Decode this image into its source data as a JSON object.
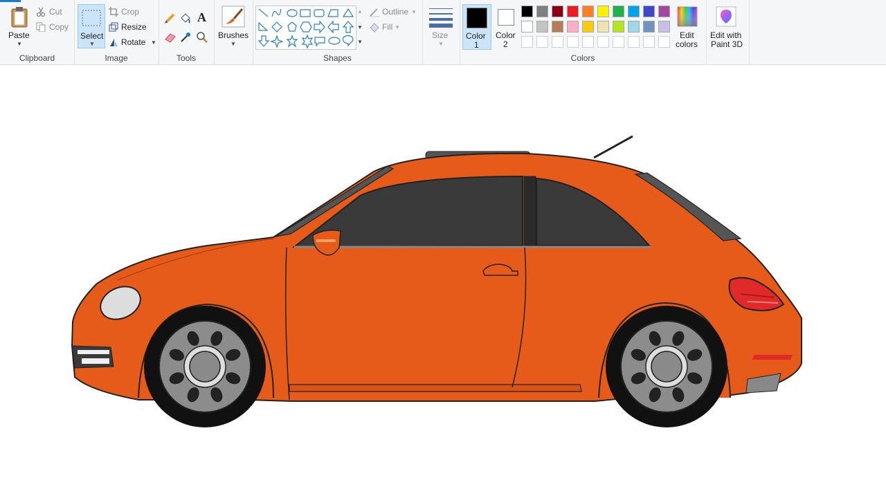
{
  "clipboard": {
    "paste": "Paste",
    "cut": "Cut",
    "copy": "Copy",
    "group": "Clipboard"
  },
  "image": {
    "select": "Select",
    "crop": "Crop",
    "resize": "Resize",
    "rotate": "Rotate",
    "group": "Image"
  },
  "tools": {
    "group": "Tools",
    "text_tool": "A"
  },
  "brushes": {
    "label": "Brushes"
  },
  "shapes": {
    "group": "Shapes",
    "outline": "Outline",
    "fill": "Fill"
  },
  "size": {
    "label": "Size"
  },
  "colors": {
    "color1_a": "Color",
    "color1_b": "1",
    "color2_a": "Color",
    "color2_b": "2",
    "group": "Colors",
    "edit_a": "Edit",
    "edit_b": "colors",
    "color1_value": "#000000",
    "color2_value": "#ffffff",
    "row1": [
      "#000000",
      "#7f7f7f",
      "#880015",
      "#ed1c24",
      "#ff7f27",
      "#fff200",
      "#22b14c",
      "#00a2e8",
      "#3f48cc",
      "#a349a4"
    ],
    "row2": [
      "#ffffff",
      "#c3c3c3",
      "#b97a57",
      "#ffaec9",
      "#ffc90e",
      "#efe4b0",
      "#b5e61d",
      "#99d9ea",
      "#7092be",
      "#c8bfe7"
    ],
    "row3": [
      "#ffffff",
      "#ffffff",
      "#ffffff",
      "#ffffff",
      "#ffffff",
      "#ffffff",
      "#ffffff",
      "#ffffff",
      "#ffffff",
      "#ffffff"
    ]
  },
  "paint3d": {
    "a": "Edit with",
    "b": "Paint 3D"
  },
  "drawing": {
    "body_color": "#e65b19",
    "window_color": "#3a3a3a",
    "tire_color": "#111111",
    "rim_color": "#8c8c8c"
  }
}
